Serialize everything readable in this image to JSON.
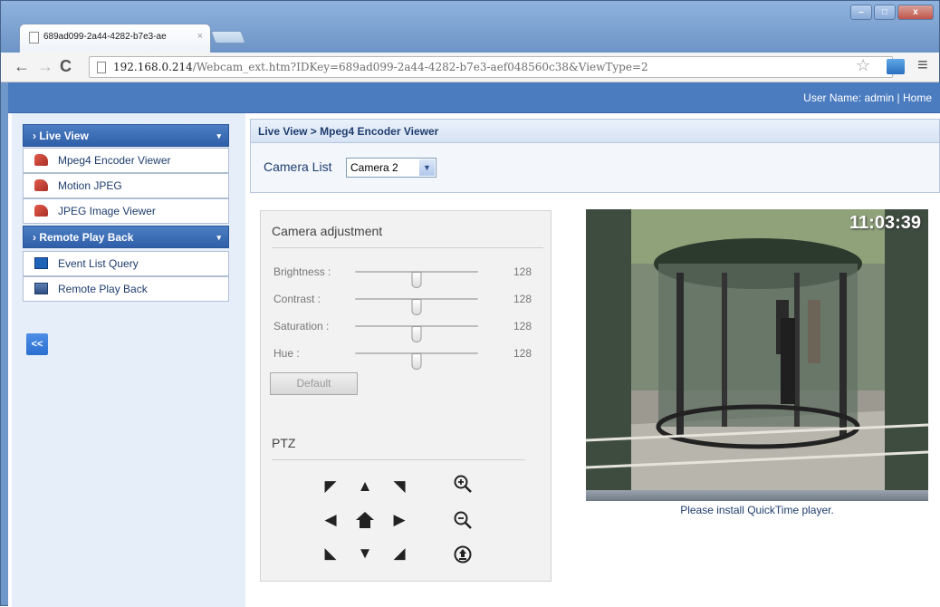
{
  "browser": {
    "tab_title": "689ad099-2a44-4282-b7e3-ae",
    "tab_close": "×",
    "url_host": "192.168.0.214",
    "url_path": "/Webcam_ext.htm?IDKey=689ad099-2a44-4282-b7e3-aef048560c38&ViewType=2",
    "window_buttons": [
      "–",
      "□",
      "x"
    ]
  },
  "header": {
    "user": "User Name: admin | Home"
  },
  "sidebar": {
    "sections": [
      {
        "title": "Live View",
        "items": [
          {
            "label": "Mpeg4 Encoder Viewer",
            "icon": "camera-icon"
          },
          {
            "label": "Motion JPEG",
            "icon": "camera-icon"
          },
          {
            "label": "JPEG Image Viewer",
            "icon": "camera-icon"
          }
        ]
      },
      {
        "title": "Remote Play Back",
        "items": [
          {
            "label": "Event List Query",
            "icon": "list-icon"
          },
          {
            "label": "Remote Play Back",
            "icon": "playback-icon"
          }
        ]
      }
    ],
    "collapse_label": "<<"
  },
  "main": {
    "breadcrumb": "Live View > Mpeg4 Encoder Viewer",
    "camera_list_label": "Camera List",
    "camera_selected": "Camera 2"
  },
  "camera_adjustment": {
    "title": "Camera adjustment",
    "sliders": [
      {
        "label": "Brightness :",
        "value": "128",
        "fraction": 0.5
      },
      {
        "label": "Contrast :",
        "value": "128",
        "fraction": 0.5
      },
      {
        "label": "Saturation :",
        "value": "128",
        "fraction": 0.5
      },
      {
        "label": "Hue :",
        "value": "128",
        "fraction": 0.5
      }
    ],
    "default_button": "Default"
  },
  "ptz": {
    "title": "PTZ"
  },
  "video": {
    "timestamp": "11:03:39",
    "message": "Please install QuickTime player."
  }
}
